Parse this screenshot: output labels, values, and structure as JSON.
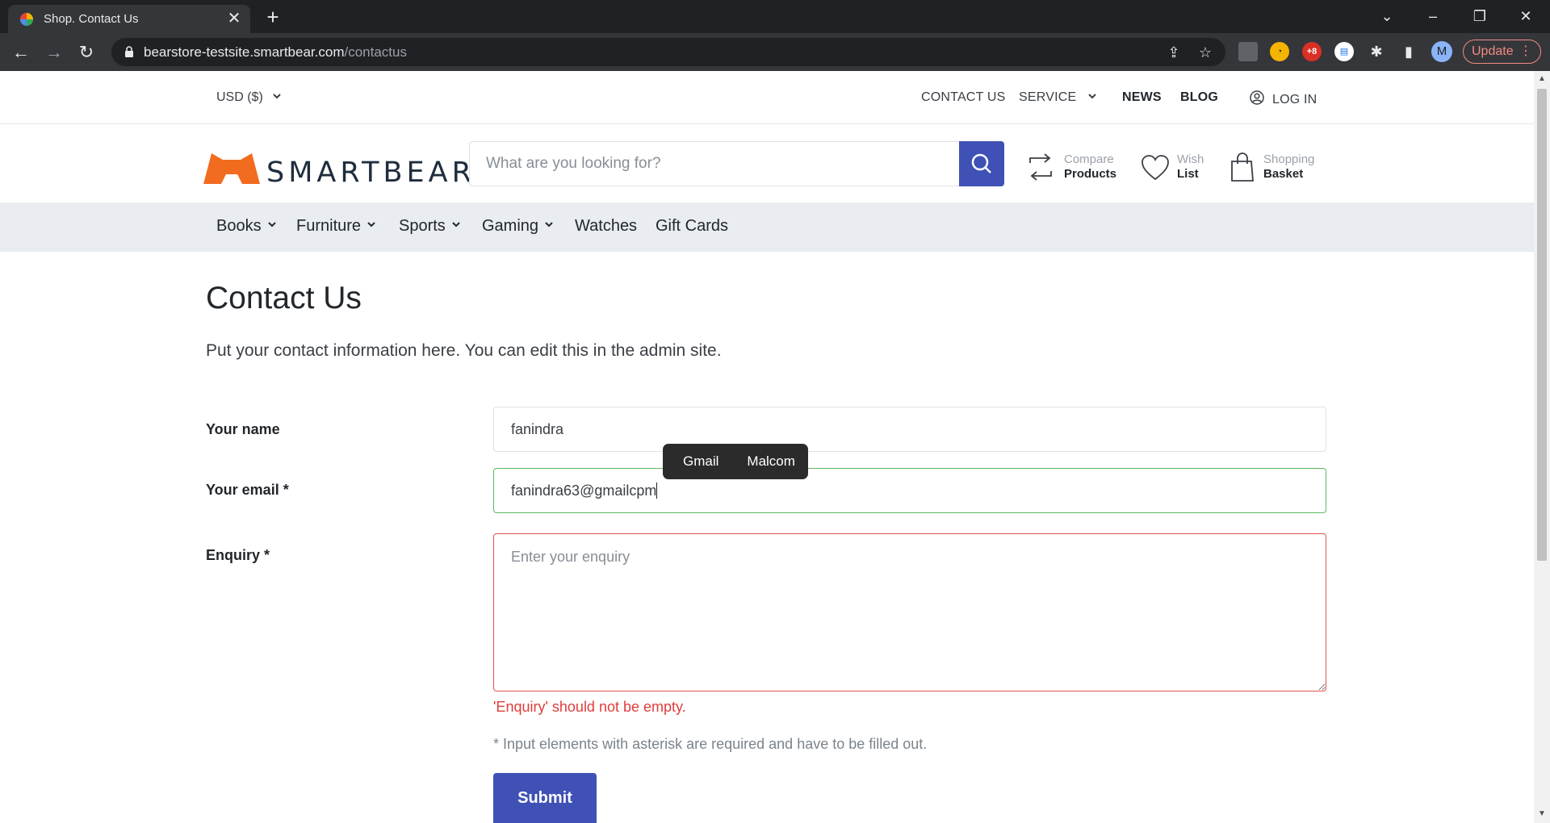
{
  "browser": {
    "tab_title": "Shop. Contact Us",
    "url_domain": "bearstore-testsite.smartbear.com",
    "url_path": "/contactus",
    "update_label": "Update",
    "profile_initial": "M"
  },
  "topbar": {
    "currency": "USD  ($)",
    "contact_us": "CONTACT US",
    "service": "SERVICE",
    "news": "NEWS",
    "blog": "BLOG",
    "login": "LOG IN"
  },
  "header": {
    "logo_text": "SMARTBEAR",
    "search_placeholder": "What are you looking for?",
    "compare_line1": "Compare",
    "compare_line2": "Products",
    "wish_line1": "Wish",
    "wish_line2": "List",
    "basket_line1": "Shopping",
    "basket_line2": "Basket"
  },
  "categories": [
    "Books",
    "Furniture",
    "Sports",
    "Gaming",
    "Watches",
    "Gift Cards"
  ],
  "page": {
    "title": "Contact Us",
    "intro": "Put your contact information here. You can edit this in the admin site."
  },
  "form": {
    "name_label": "Your name",
    "name_value": "fanindra",
    "email_label": "Your email *",
    "email_value": "fanindra63@gmailcpm",
    "enquiry_label": "Enquiry *",
    "enquiry_placeholder": "Enter your enquiry",
    "enquiry_error": "'Enquiry' should not be empty.",
    "required_hint": "* Input elements with asterisk are required and have to be filled out.",
    "submit_label": "Submit"
  },
  "autocomplete": {
    "options": [
      "Gmail",
      "Malcom"
    ]
  },
  "colors": {
    "accent": "#3f51b5",
    "brand_orange": "#f26c1f",
    "error": "#e03c3c",
    "valid": "#5cb85c"
  }
}
